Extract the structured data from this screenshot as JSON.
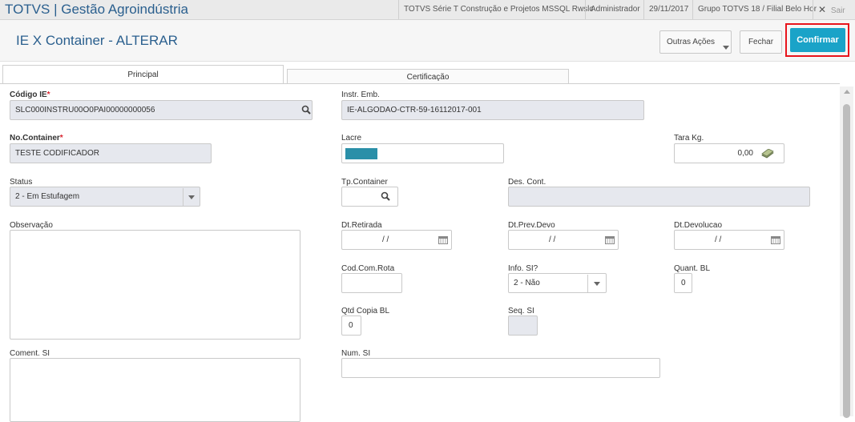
{
  "topbar": {
    "app_title": "TOTVS | Gestão Agroindústria",
    "environment": "TOTVS Série T Construção e Projetos MSSQL Rwslc",
    "user": "Administrador",
    "date": "29/11/2017",
    "branch": "Grupo TOTVS 18 / Filial Belo Hor",
    "exit_label": "Sair"
  },
  "header": {
    "title": "IE X Container - ALTERAR",
    "more_actions": "Outras Ações",
    "close": "Fechar",
    "confirm": "Confirmar"
  },
  "tabs": [
    "Principal",
    "Certificação"
  ],
  "form": {
    "codigo_ie": {
      "label": "Código IE",
      "value": "SLC000INSTRU00O0PAI00000000056"
    },
    "instr_emb": {
      "label": "Instr. Emb.",
      "value": "IE-ALGODAO-CTR-59-16112017-001"
    },
    "no_container": {
      "label": "No.Container",
      "value": "TESTE CODIFICADOR"
    },
    "lacre": {
      "label": "Lacre",
      "value": ""
    },
    "tara": {
      "label": "Tara Kg.",
      "value": "0,00"
    },
    "status": {
      "label": "Status",
      "value": "2 - Em Estufagem"
    },
    "tp_container": {
      "label": "Tp.Container",
      "value": ""
    },
    "des_cont": {
      "label": "Des. Cont.",
      "value": ""
    },
    "observacao": {
      "label": "Observação"
    },
    "dt_retirada": {
      "label": "Dt.Retirada",
      "value": "/ /"
    },
    "dt_prev_devo": {
      "label": "Dt.Prev.Devo",
      "value": "/ /"
    },
    "dt_devolucao": {
      "label": "Dt.Devolucao",
      "value": "/ /"
    },
    "cod_com_rota": {
      "label": "Cod.Com.Rota",
      "value": ""
    },
    "info_si": {
      "label": "Info. SI?",
      "value": "2 - Não"
    },
    "quant_bl": {
      "label": "Quant. BL",
      "value": "0"
    },
    "qtd_copia_bl": {
      "label": "Qtd Copia BL",
      "value": "0"
    },
    "seq_si": {
      "label": "Seq. SI",
      "value": ""
    },
    "coment_si": {
      "label": "Coment. SI"
    },
    "num_si": {
      "label": "Num. SI",
      "value": ""
    }
  },
  "colors": {
    "accent": "#2a5f8e",
    "primary_button": "#1aa3c8",
    "required": "#d9232e",
    "highlight": "#e8141c"
  }
}
